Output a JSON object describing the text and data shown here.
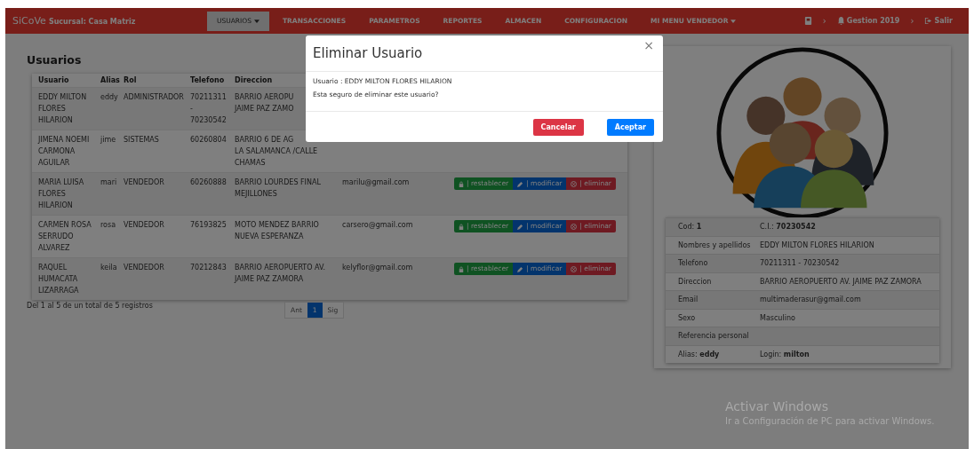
{
  "navbar": {
    "brand": "SiCoVe",
    "branch": "Sucursal: Casa Matriz",
    "items": [
      {
        "label": "USUARIOS",
        "kind": "dropdown",
        "selected": true
      },
      {
        "label": "TRANSACCIONES",
        "kind": "link",
        "selected": false
      },
      {
        "label": "PARAMETROS",
        "kind": "link",
        "selected": false
      },
      {
        "label": "REPORTES",
        "kind": "link",
        "selected": false
      },
      {
        "label": "ALMACEN",
        "kind": "link",
        "selected": false
      },
      {
        "label": "CONFIGURACION",
        "kind": "link",
        "selected": false
      },
      {
        "label": "MI MENU VENDEDOR",
        "kind": "dropdown",
        "selected": false
      }
    ],
    "right": [
      {
        "kind": "id-card",
        "label": "›"
      },
      {
        "kind": "bell",
        "label": "Gestion 2019"
      },
      {
        "kind": "chevron",
        "label": "›"
      },
      {
        "kind": "sign-out",
        "label": "Salir"
      }
    ]
  },
  "users": {
    "title": "Usuarios",
    "columns": [
      "Usuario",
      "Alias",
      "Rol",
      "Telefono",
      "Direccion"
    ],
    "rows": [
      {
        "usuario": "EDDY MILTON FLORES HILARION",
        "alias": "eddy",
        "rol": "ADMINISTRADOR",
        "telefono": "70211311 - 70230542",
        "direccion": [
          "BARRIO AEROPU",
          "JAIME PAZ ZAMO"
        ]
      },
      {
        "usuario": "JIMENA NOEMI CARMONA AGUILAR",
        "alias": "jime",
        "rol": "SISTEMAS",
        "telefono": "60260804",
        "direccion": [
          "BARRIO 6 DE AG",
          "LA SALAMANCA /CALLE",
          "CHAMAS"
        ]
      },
      {
        "usuario": "MARIA LUISA FLORES HILARION",
        "alias": "mari",
        "rol": "VENDEDOR",
        "telefono": "60260888",
        "direccion": [
          "BARRIO LOURDES FINAL",
          "MEJILLONES"
        ],
        "email": "marilu@gmail.com",
        "actions": [
          {
            "kind": "reset",
            "label": "| restablecer"
          },
          {
            "kind": "edit",
            "label": "| modificar"
          },
          {
            "kind": "delete",
            "label": "| eliminar"
          }
        ]
      },
      {
        "usuario": "CARMEN ROSA SERRUDO ALVAREZ",
        "alias": "rosa",
        "rol": "VENDEDOR",
        "telefono": "76193825",
        "direccion": [
          "MOTO MENDEZ BARRIO",
          "NUEVA ESPERANZA"
        ],
        "email": "carsero@gmail.com",
        "actions": [
          {
            "kind": "reset",
            "label": "| restablecer"
          },
          {
            "kind": "edit",
            "label": "| modificar"
          },
          {
            "kind": "delete",
            "label": "| eliminar"
          }
        ]
      },
      {
        "usuario": "RAQUEL HUMACATA LIZARRAGA",
        "alias": "keila",
        "rol": "VENDEDOR",
        "telefono": "70212843",
        "direccion": [
          "BARRIO AEROPUERTO AV.",
          "JAIME PAZ ZAMORA"
        ],
        "email": "kelyflor@gmail.com",
        "actions": [
          {
            "kind": "reset",
            "label": "| restablecer"
          },
          {
            "kind": "edit",
            "label": "| modificar"
          },
          {
            "kind": "delete",
            "label": "| eliminar"
          }
        ]
      }
    ],
    "summary": "Del 1 al 5 de un total de 5 registros",
    "pagination": [
      {
        "label": "Ant",
        "selected": false
      },
      {
        "label": "1",
        "selected": true
      },
      {
        "label": "Sig",
        "selected": false
      }
    ]
  },
  "profile": {
    "rows": [
      {
        "left": "Cod: **1**",
        "right": "C.I.: **70230542**"
      },
      {
        "left": "Nombres y apellidos",
        "right": "EDDY MILTON FLORES HILARION"
      },
      {
        "left": "Telefono",
        "right": "70211311 - 70230542"
      },
      {
        "left": "Direccion",
        "right": "BARRIO AEROPUERTO AV. JAIME PAZ ZAMORA"
      },
      {
        "left": "Email",
        "right": "multimaderasur@gmail.com"
      },
      {
        "left": "Sexo",
        "right": "Masculino"
      },
      {
        "left": "Referencia personal"
      },
      {
        "left": "Alias: **eddy**",
        "right": "Login: **milton**"
      }
    ]
  },
  "modal": {
    "title": "Eliminar Usuario",
    "close": "×",
    "lines": [
      "Usuario : EDDY MILTON FLORES HILARION",
      "Esta seguro de eliminar este usuario?"
    ],
    "buttons": [
      {
        "kind": "cancel",
        "label": "Cancelar"
      },
      {
        "kind": "confirm",
        "label": "Aceptar"
      }
    ]
  },
  "activation_notice": {
    "title": "Activar Windows",
    "message": "Ir a Configuración de PC para activar Windows."
  }
}
